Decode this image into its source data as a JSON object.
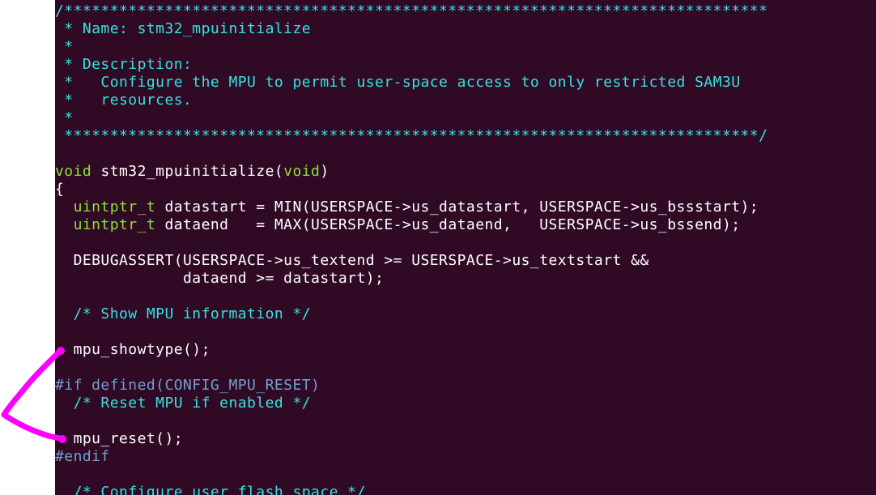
{
  "colors": {
    "background": "#300a24",
    "text": "#ffffff",
    "comment": "#34e2e2",
    "type": "#8ae234",
    "preprocessor": "#729fcf",
    "annotation": "#ff00ff"
  },
  "code": {
    "l1": "/*****************************************************************************",
    "l2": " * Name: stm32_mpuinitialize",
    "l3": " *",
    "l4": " * Description:",
    "l5": " *   Configure the MPU to permit user-space access to only restricted SAM3U",
    "l6": " *   resources.",
    "l7": " *",
    "l8": " ****************************************************************************/",
    "l10_void": "void",
    "l10_name": " stm32_mpuinitialize(",
    "l10_arg": "void",
    "l10_close": ")",
    "l11": "{",
    "l12_type": "  uintptr_t",
    "l12_rest": " datastart = MIN(USERSPACE->us_datastart, USERSPACE->us_bssstart);",
    "l13_type": "  uintptr_t",
    "l13_rest": " dataend   = MAX(USERSPACE->us_dataend,   USERSPACE->us_bssend);",
    "l15": "  DEBUGASSERT(USERSPACE->us_textend >= USERSPACE->us_textstart &&",
    "l16": "              dataend >= datastart);",
    "l18": "  /* Show MPU information */",
    "l20": "  mpu_showtype();",
    "l22": "#if defined(CONFIG_MPU_RESET)",
    "l23": "  /* Reset MPU if enabled */",
    "l25": "  mpu_reset();",
    "l26": "#endif",
    "l28": "  /* Configure user flash space */"
  }
}
